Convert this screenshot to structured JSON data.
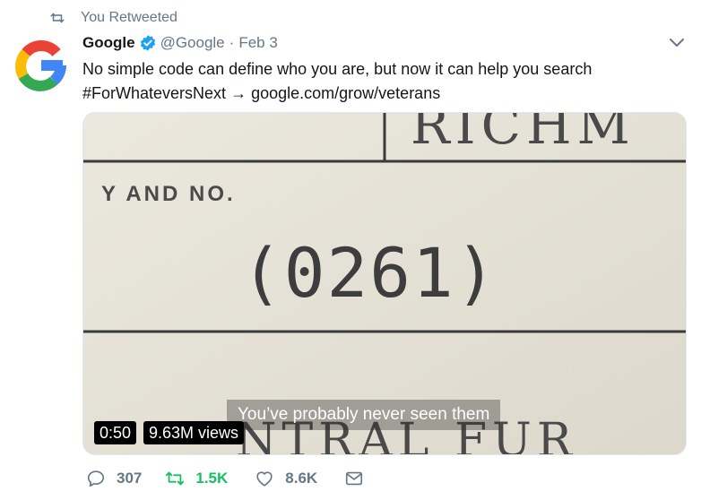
{
  "context": {
    "retweet_label": "You Retweeted"
  },
  "tweet": {
    "author_name": "Google",
    "handle": "@Google",
    "separator": "·",
    "date": "Feb 3",
    "text_line1": "No simple code can define who you are, but now it can help you search",
    "hashtag": "#ForWhateversNext",
    "arrow": "→",
    "link": "google.com/grow/veterans"
  },
  "media": {
    "document_top_text": "RICHM",
    "document_label": "Y AND NO.",
    "document_code": "(0261)",
    "document_bottom_text": "NTRAL FUR",
    "subtitle": "You’ve probably never seen them",
    "duration": "0:50",
    "views": "9.63M views"
  },
  "actions": {
    "replies": "307",
    "retweets": "1.5K",
    "likes": "8.6K"
  },
  "colors": {
    "retweet_active": "#17bf63",
    "secondary_text": "#657786",
    "verified_blue": "#1da1f2"
  }
}
